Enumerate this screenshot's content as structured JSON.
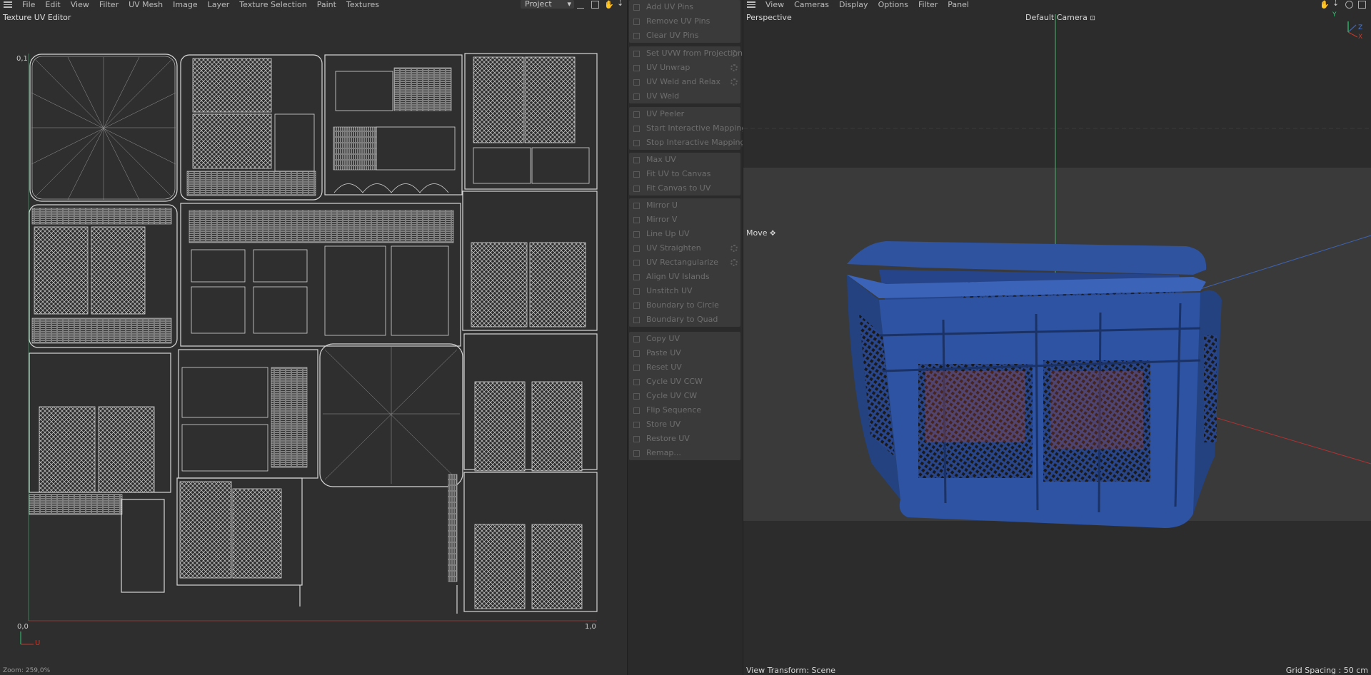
{
  "uv_editor": {
    "menu": [
      "File",
      "Edit",
      "View",
      "Filter",
      "UV Mesh",
      "Image",
      "Layer",
      "Texture Selection",
      "Paint",
      "Textures"
    ],
    "project_dropdown": "Project",
    "panel_title": "Texture UV Editor",
    "corner_top_left": "0,1",
    "corner_bottom_left": "0,0",
    "corner_bottom_right": "1,0",
    "axis_u": "U",
    "zoom": "Zoom: 259,0%"
  },
  "uv_commands": {
    "groups": [
      [
        "Add UV Pins",
        "Remove UV Pins",
        "Clear UV Pins"
      ],
      [
        "Set UVW from Projection",
        "UV Unwrap",
        "UV Weld and Relax",
        "UV Weld"
      ],
      [
        "UV Peeler",
        "Start Interactive Mapping",
        "Stop Interactive Mapping"
      ],
      [
        "Max UV",
        "Fit UV to Canvas",
        "Fit Canvas to UV"
      ],
      [
        "Mirror U",
        "Mirror V",
        "Line Up UV",
        "UV Straighten",
        "UV Rectangularize",
        "Align UV Islands",
        "Unstitch UV",
        "Boundary to Circle",
        "Boundary to Quad"
      ],
      [
        "Copy UV",
        "Paste UV",
        "Reset UV",
        "Cycle UV CCW",
        "Cycle UV CW",
        "Flip Sequence",
        "Store UV",
        "Restore UV",
        "Remap..."
      ]
    ]
  },
  "viewport": {
    "menu": [
      "View",
      "Cameras",
      "Display",
      "Options",
      "Filter",
      "Panel"
    ],
    "view_name": "Perspective",
    "camera": "Default Camera",
    "tool": "Move",
    "view_transform": "View Transform: Scene",
    "grid_spacing": "Grid Spacing : 50 cm",
    "axis_labels": {
      "y": "Y",
      "z": "Z",
      "x": "X"
    }
  },
  "colors": {
    "crate_blue": "#2e55a0",
    "uv_line": "#d0d0d0",
    "accent_red": "#c0392b",
    "accent_green": "#2ecc71"
  }
}
